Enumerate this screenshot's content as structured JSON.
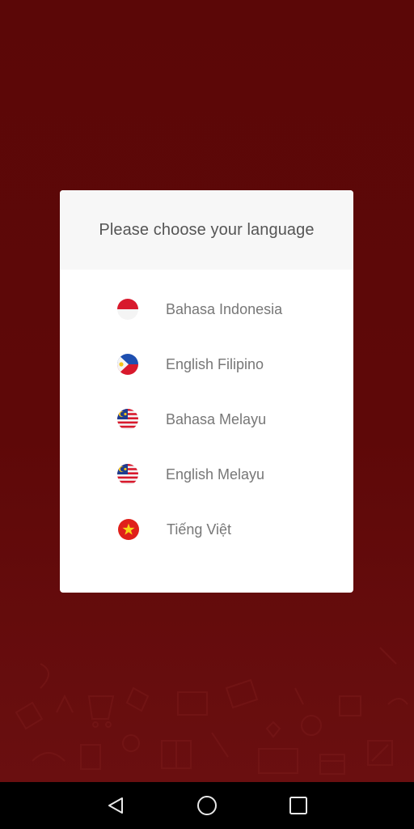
{
  "dialog": {
    "title": "Please choose your language",
    "languages": [
      {
        "label": "Bahasa Indonesia",
        "flag_icon": "indonesia-flag-icon"
      },
      {
        "label": "English Filipino",
        "flag_icon": "philippines-flag-icon"
      },
      {
        "label": "Bahasa Melayu",
        "flag_icon": "malaysia-flag-icon"
      },
      {
        "label": "English Melayu",
        "flag_icon": "malaysia-flag-icon"
      },
      {
        "label": "Tiếng Việt",
        "flag_icon": "vietnam-flag-icon"
      }
    ]
  },
  "nav_bar": {
    "buttons": [
      {
        "icon": "back-triangle-icon"
      },
      {
        "icon": "home-circle-icon"
      },
      {
        "icon": "recents-square-icon"
      }
    ]
  },
  "colors": {
    "background": "#5b0707",
    "dialog": "#ffffff",
    "header": "#f7f7f7",
    "title_text": "#555555",
    "item_text": "#777777"
  }
}
